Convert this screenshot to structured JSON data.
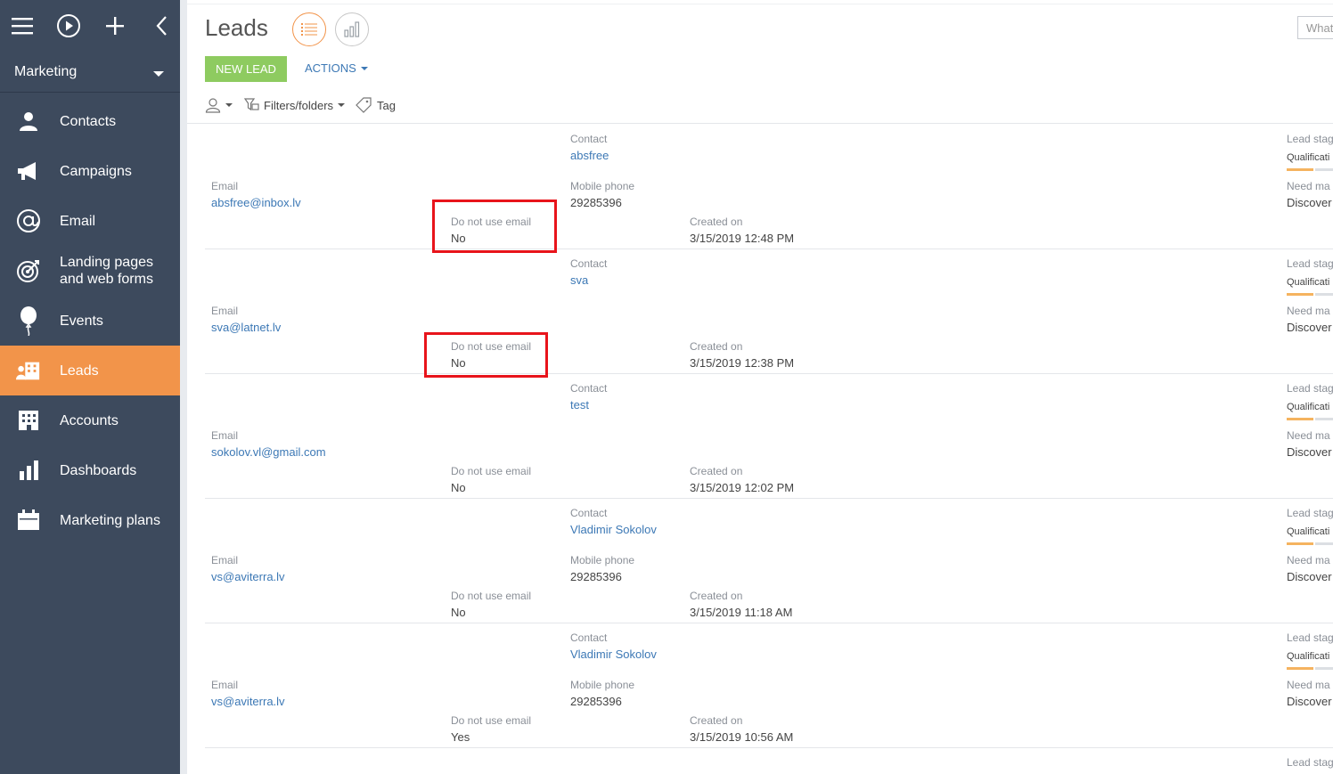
{
  "sidebar": {
    "section_label": "Marketing",
    "items": [
      {
        "label": "Contacts",
        "icon": "person-icon",
        "active": false
      },
      {
        "label": "Campaigns",
        "icon": "megaphone-icon",
        "active": false
      },
      {
        "label": "Email",
        "icon": "at-sign-icon",
        "active": false
      },
      {
        "label": "Landing pages\nand web forms",
        "icon": "target-icon",
        "active": false
      },
      {
        "label": "Events",
        "icon": "balloon-icon",
        "active": false
      },
      {
        "label": "Leads",
        "icon": "leads-icon",
        "active": true
      },
      {
        "label": "Accounts",
        "icon": "building-icon",
        "active": false
      },
      {
        "label": "Dashboards",
        "icon": "bar-chart-icon",
        "active": false
      },
      {
        "label": "Marketing plans",
        "icon": "calendar-icon",
        "active": false
      }
    ]
  },
  "header": {
    "title": "Leads",
    "new_lead_label": "NEW LEAD",
    "actions_label": "ACTIONS",
    "search_placeholder": "What"
  },
  "filters": {
    "folders_label": "Filters/folders",
    "tag_label": "Tag"
  },
  "captions": {
    "contact": "Contact",
    "email": "Email",
    "mobile_phone": "Mobile phone",
    "do_not_use_email": "Do not use email",
    "created_on": "Created on",
    "lead_stage": "Lead stag",
    "need_ma": "Need ma"
  },
  "records": [
    {
      "contact": "absfree",
      "email": "absfree@inbox.lv",
      "mobile_phone": "29285396",
      "do_not_use_email": "No",
      "created_on": "3/15/2019 12:48 PM",
      "stage": "Qualificati",
      "need": "Discover"
    },
    {
      "contact": "sva",
      "email": "sva@latnet.lv",
      "mobile_phone": "",
      "do_not_use_email": "No",
      "created_on": "3/15/2019 12:38 PM",
      "stage": "Qualificati",
      "need": "Discover"
    },
    {
      "contact": "test",
      "email": "sokolov.vl@gmail.com",
      "mobile_phone": "",
      "do_not_use_email": "No",
      "created_on": "3/15/2019 12:02 PM",
      "stage": "Qualificati",
      "need": "Discover"
    },
    {
      "contact": "Vladimir Sokolov",
      "email": "vs@aviterra.lv",
      "mobile_phone": "29285396",
      "do_not_use_email": "No",
      "created_on": "3/15/2019 11:18 AM",
      "stage": "Qualificati",
      "need": "Discover"
    },
    {
      "contact": "Vladimir Sokolov",
      "email": "vs@aviterra.lv",
      "mobile_phone": "29285396",
      "do_not_use_email": "Yes",
      "created_on": "3/15/2019 10:56 AM",
      "stage": "Qualificati",
      "need": "Discover"
    }
  ],
  "partial_row": {
    "lead_stage": "Lead stag"
  },
  "colors": {
    "sidebar_bg": "#3d4a5d",
    "active_bg": "#f2944a",
    "new_lead_bg": "#8ecb60",
    "link": "#3c78b5",
    "highlight": "#e8141b"
  }
}
